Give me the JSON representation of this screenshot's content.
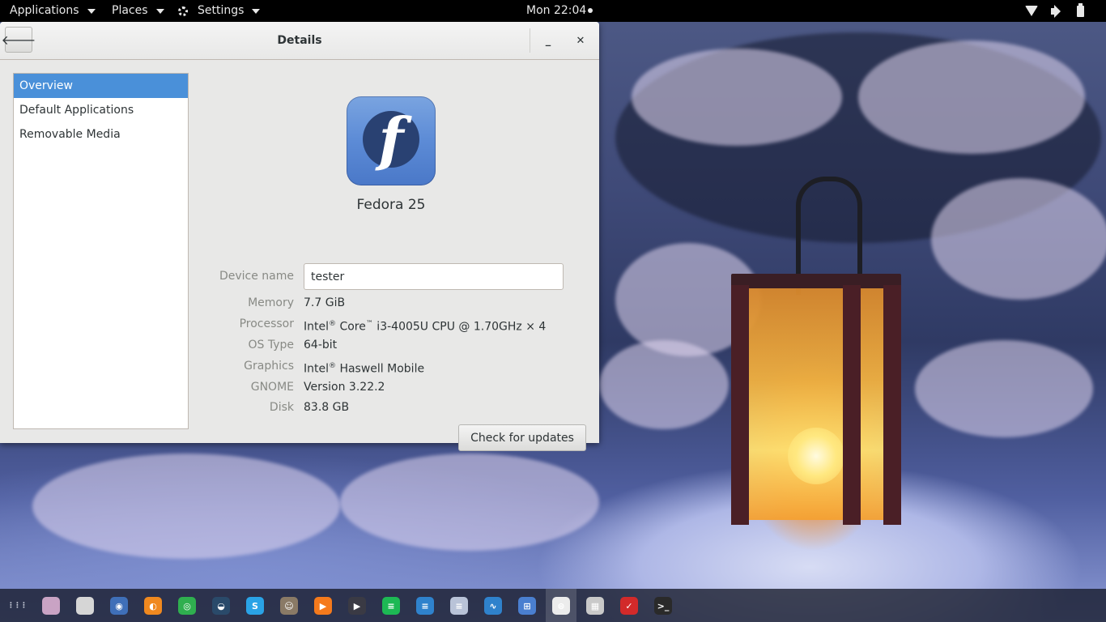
{
  "topbar": {
    "applications_label": "Applications",
    "places_label": "Places",
    "settings_label": "Settings",
    "clock": "Mon 22:04",
    "tray_icons": [
      "wifi-icon",
      "volume-icon",
      "battery-icon"
    ]
  },
  "window": {
    "title": "Details",
    "back_glyph": "🡐",
    "minimize_glyph": "_",
    "close_glyph": "✕"
  },
  "sidebar": {
    "items": [
      {
        "label": "Overview",
        "selected": true
      },
      {
        "label": "Default Applications",
        "selected": false
      },
      {
        "label": "Removable Media",
        "selected": false
      }
    ]
  },
  "overview": {
    "logo_glyph": "f",
    "os_name": "Fedora 25",
    "device_name_label": "Device name",
    "device_name_value": "tester",
    "memory_label": "Memory",
    "memory_value": "7.7 GiB",
    "processor_label": "Processor",
    "processor_value_a": "Intel",
    "processor_value_b": " Core",
    "processor_value_c": " i3-4005U CPU @ 1.70GHz × 4",
    "os_type_label": "OS Type",
    "os_type_value": "64-bit",
    "graphics_label": "Graphics",
    "graphics_value_a": "Intel",
    "graphics_value_b": " Haswell Mobile",
    "gnome_label": "GNOME",
    "gnome_value": "Version 3.22.2",
    "disk_label": "Disk",
    "disk_value": "83.8 GB",
    "reg_mark": "®",
    "tm_mark": "™",
    "update_button": "Check for updates"
  },
  "colors": {
    "selection": "#4a90d9",
    "topbar": "#000000",
    "window_bg": "#e8e8e7"
  },
  "dock": {
    "icons": [
      {
        "name": "app-grid-icon",
        "color": "transparent",
        "glyph": "⋮⋮⋮"
      },
      {
        "name": "files-pink-icon",
        "color": "#c9a3c4",
        "glyph": ""
      },
      {
        "name": "folder-icon",
        "color": "#d6d6d6",
        "glyph": ""
      },
      {
        "name": "screenshot-icon",
        "color": "#3f6fb8",
        "glyph": "◉"
      },
      {
        "name": "firefox-icon",
        "color": "#f0891f",
        "glyph": "◐"
      },
      {
        "name": "chrome-icon",
        "color": "#2faf4f",
        "glyph": "◎"
      },
      {
        "name": "steam-icon",
        "color": "#2a4a6a",
        "glyph": "◒"
      },
      {
        "name": "skype-icon",
        "color": "#2aa3e6",
        "glyph": "S"
      },
      {
        "name": "gimp-icon",
        "color": "#8a7a66",
        "glyph": "☺"
      },
      {
        "name": "media-player-icon",
        "color": "#f57a1c",
        "glyph": "▶"
      },
      {
        "name": "video-player-icon",
        "color": "#3a3a44",
        "glyph": "▶"
      },
      {
        "name": "spotify-icon",
        "color": "#1db954",
        "glyph": "≡"
      },
      {
        "name": "text-editor-icon",
        "color": "#2f82cc",
        "glyph": "≡"
      },
      {
        "name": "notes-icon",
        "color": "#b9c3d8",
        "glyph": "≡"
      },
      {
        "name": "system-monitor-icon",
        "color": "#2f82cc",
        "glyph": "∿"
      },
      {
        "name": "calculator-icon",
        "color": "#4a7fd0",
        "glyph": "⊞"
      },
      {
        "name": "settings-toggle-icon",
        "color": "#ececec",
        "glyph": "⊜"
      },
      {
        "name": "disks-icon",
        "color": "#c9c9c9",
        "glyph": "▦"
      },
      {
        "name": "software-icon",
        "color": "#d22a2a",
        "glyph": "✓"
      },
      {
        "name": "terminal-icon",
        "color": "#2a2a2a",
        "glyph": ">_"
      }
    ]
  }
}
